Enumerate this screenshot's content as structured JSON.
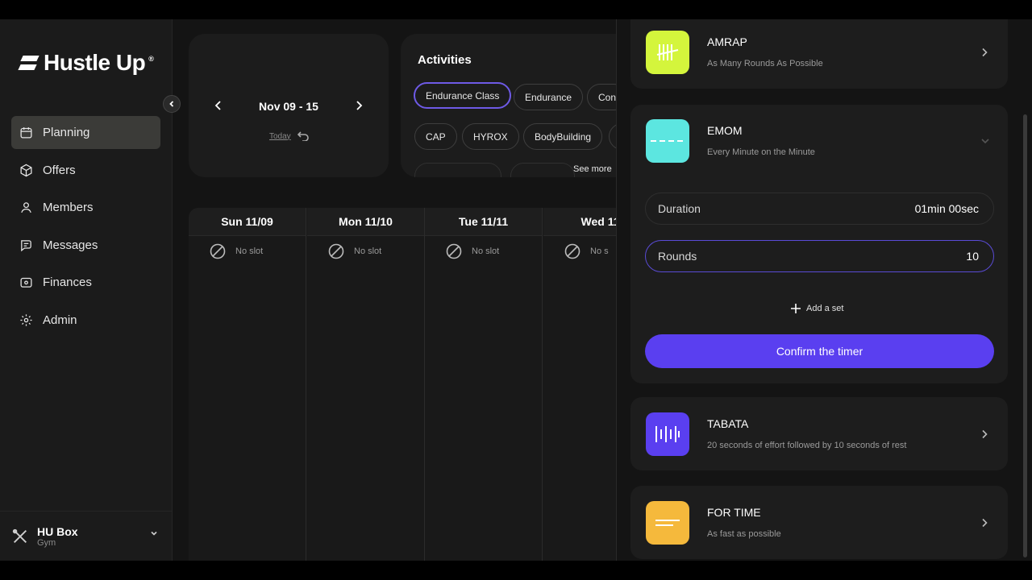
{
  "sidebar": {
    "logo": "Hustle Up",
    "logo_mark": "®",
    "items": [
      {
        "label": "Planning",
        "icon": "calendar-icon"
      },
      {
        "label": "Offers",
        "icon": "box-icon"
      },
      {
        "label": "Members",
        "icon": "user-icon"
      },
      {
        "label": "Messages",
        "icon": "chat-icon"
      },
      {
        "label": "Finances",
        "icon": "wallet-icon"
      },
      {
        "label": "Admin",
        "icon": "gear-icon"
      }
    ],
    "account": {
      "name": "HU Box",
      "type": "Gym"
    }
  },
  "week": {
    "range": "Nov 09 - 15",
    "today": "Today"
  },
  "activities": {
    "title": "Activities",
    "chips": [
      "Endurance Class",
      "Endurance",
      "Con",
      "CAP",
      "HYROX",
      "BodyBuilding"
    ],
    "see_more": "See more"
  },
  "calendar": {
    "days": [
      "Sun 11/09",
      "Mon 11/10",
      "Tue 11/11",
      "Wed 11/"
    ],
    "empty_text": [
      "No slot",
      "No slot",
      "No slot",
      "No s"
    ]
  },
  "timers": {
    "amrap": {
      "name": "AMRAP",
      "desc": "As Many Rounds As Possible",
      "color": "#d4f53c"
    },
    "emom": {
      "name": "EMOM",
      "desc": "Every Minute on the Minute",
      "color": "#5ce6e0"
    },
    "tabata": {
      "name": "TABATA",
      "desc": "20 seconds of effort followed by 10 seconds of rest",
      "color": "#5a3ff0"
    },
    "fortime": {
      "name": "FOR TIME",
      "desc": "As fast as possible",
      "color": "#f5b93c"
    }
  },
  "emom_form": {
    "duration_label": "Duration",
    "duration_value": "01min 00sec",
    "rounds_label": "Rounds",
    "rounds_value": "10",
    "add_set": "Add a set",
    "confirm": "Confirm the timer"
  },
  "colors": {
    "accent": "#5a3ff0",
    "selected_chip": "#6e5ae6"
  }
}
